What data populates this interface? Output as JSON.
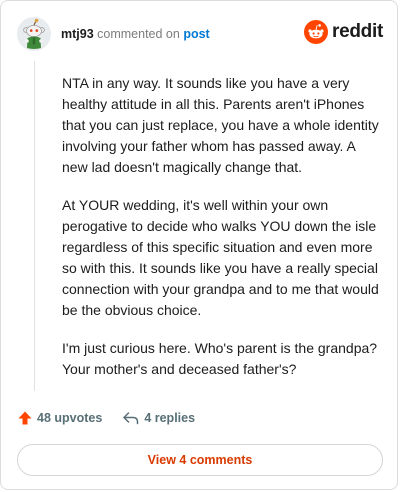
{
  "header": {
    "username": "mtj93",
    "verb": "commented on",
    "post_link": "post",
    "brand": "reddit",
    "avatar_icon": "snoo-avatar-icon",
    "brand_icon": "reddit-snoo-icon"
  },
  "comment": {
    "paragraphs": [
      "NTA in any way. It sounds like you have a very healthy attitude in all this. Parents aren't iPhones that you can just replace, you have a whole identity involving your father whom has passed away. A new lad doesn't magically change that.",
      "At YOUR wedding, it's well within your own perogative to decide who walks YOU down the isle regardless of this specific situation and even more so with this. It sounds like you have a really special connection with your grandpa and to me that would be the obvious choice.",
      "I'm just curious here. Who's parent is the grandpa? Your mother's and deceased father's?"
    ]
  },
  "actions": {
    "upvotes": "48 upvotes",
    "replies": "4 replies",
    "upvote_icon": "upvote-arrow-icon",
    "reply_icon": "reply-arrow-icon"
  },
  "footer": {
    "view_comments": "View 4 comments"
  },
  "colors": {
    "accent": "#ff4500",
    "link": "#0079d3",
    "view_button_text": "#d93a00",
    "muted": "#576f76"
  }
}
